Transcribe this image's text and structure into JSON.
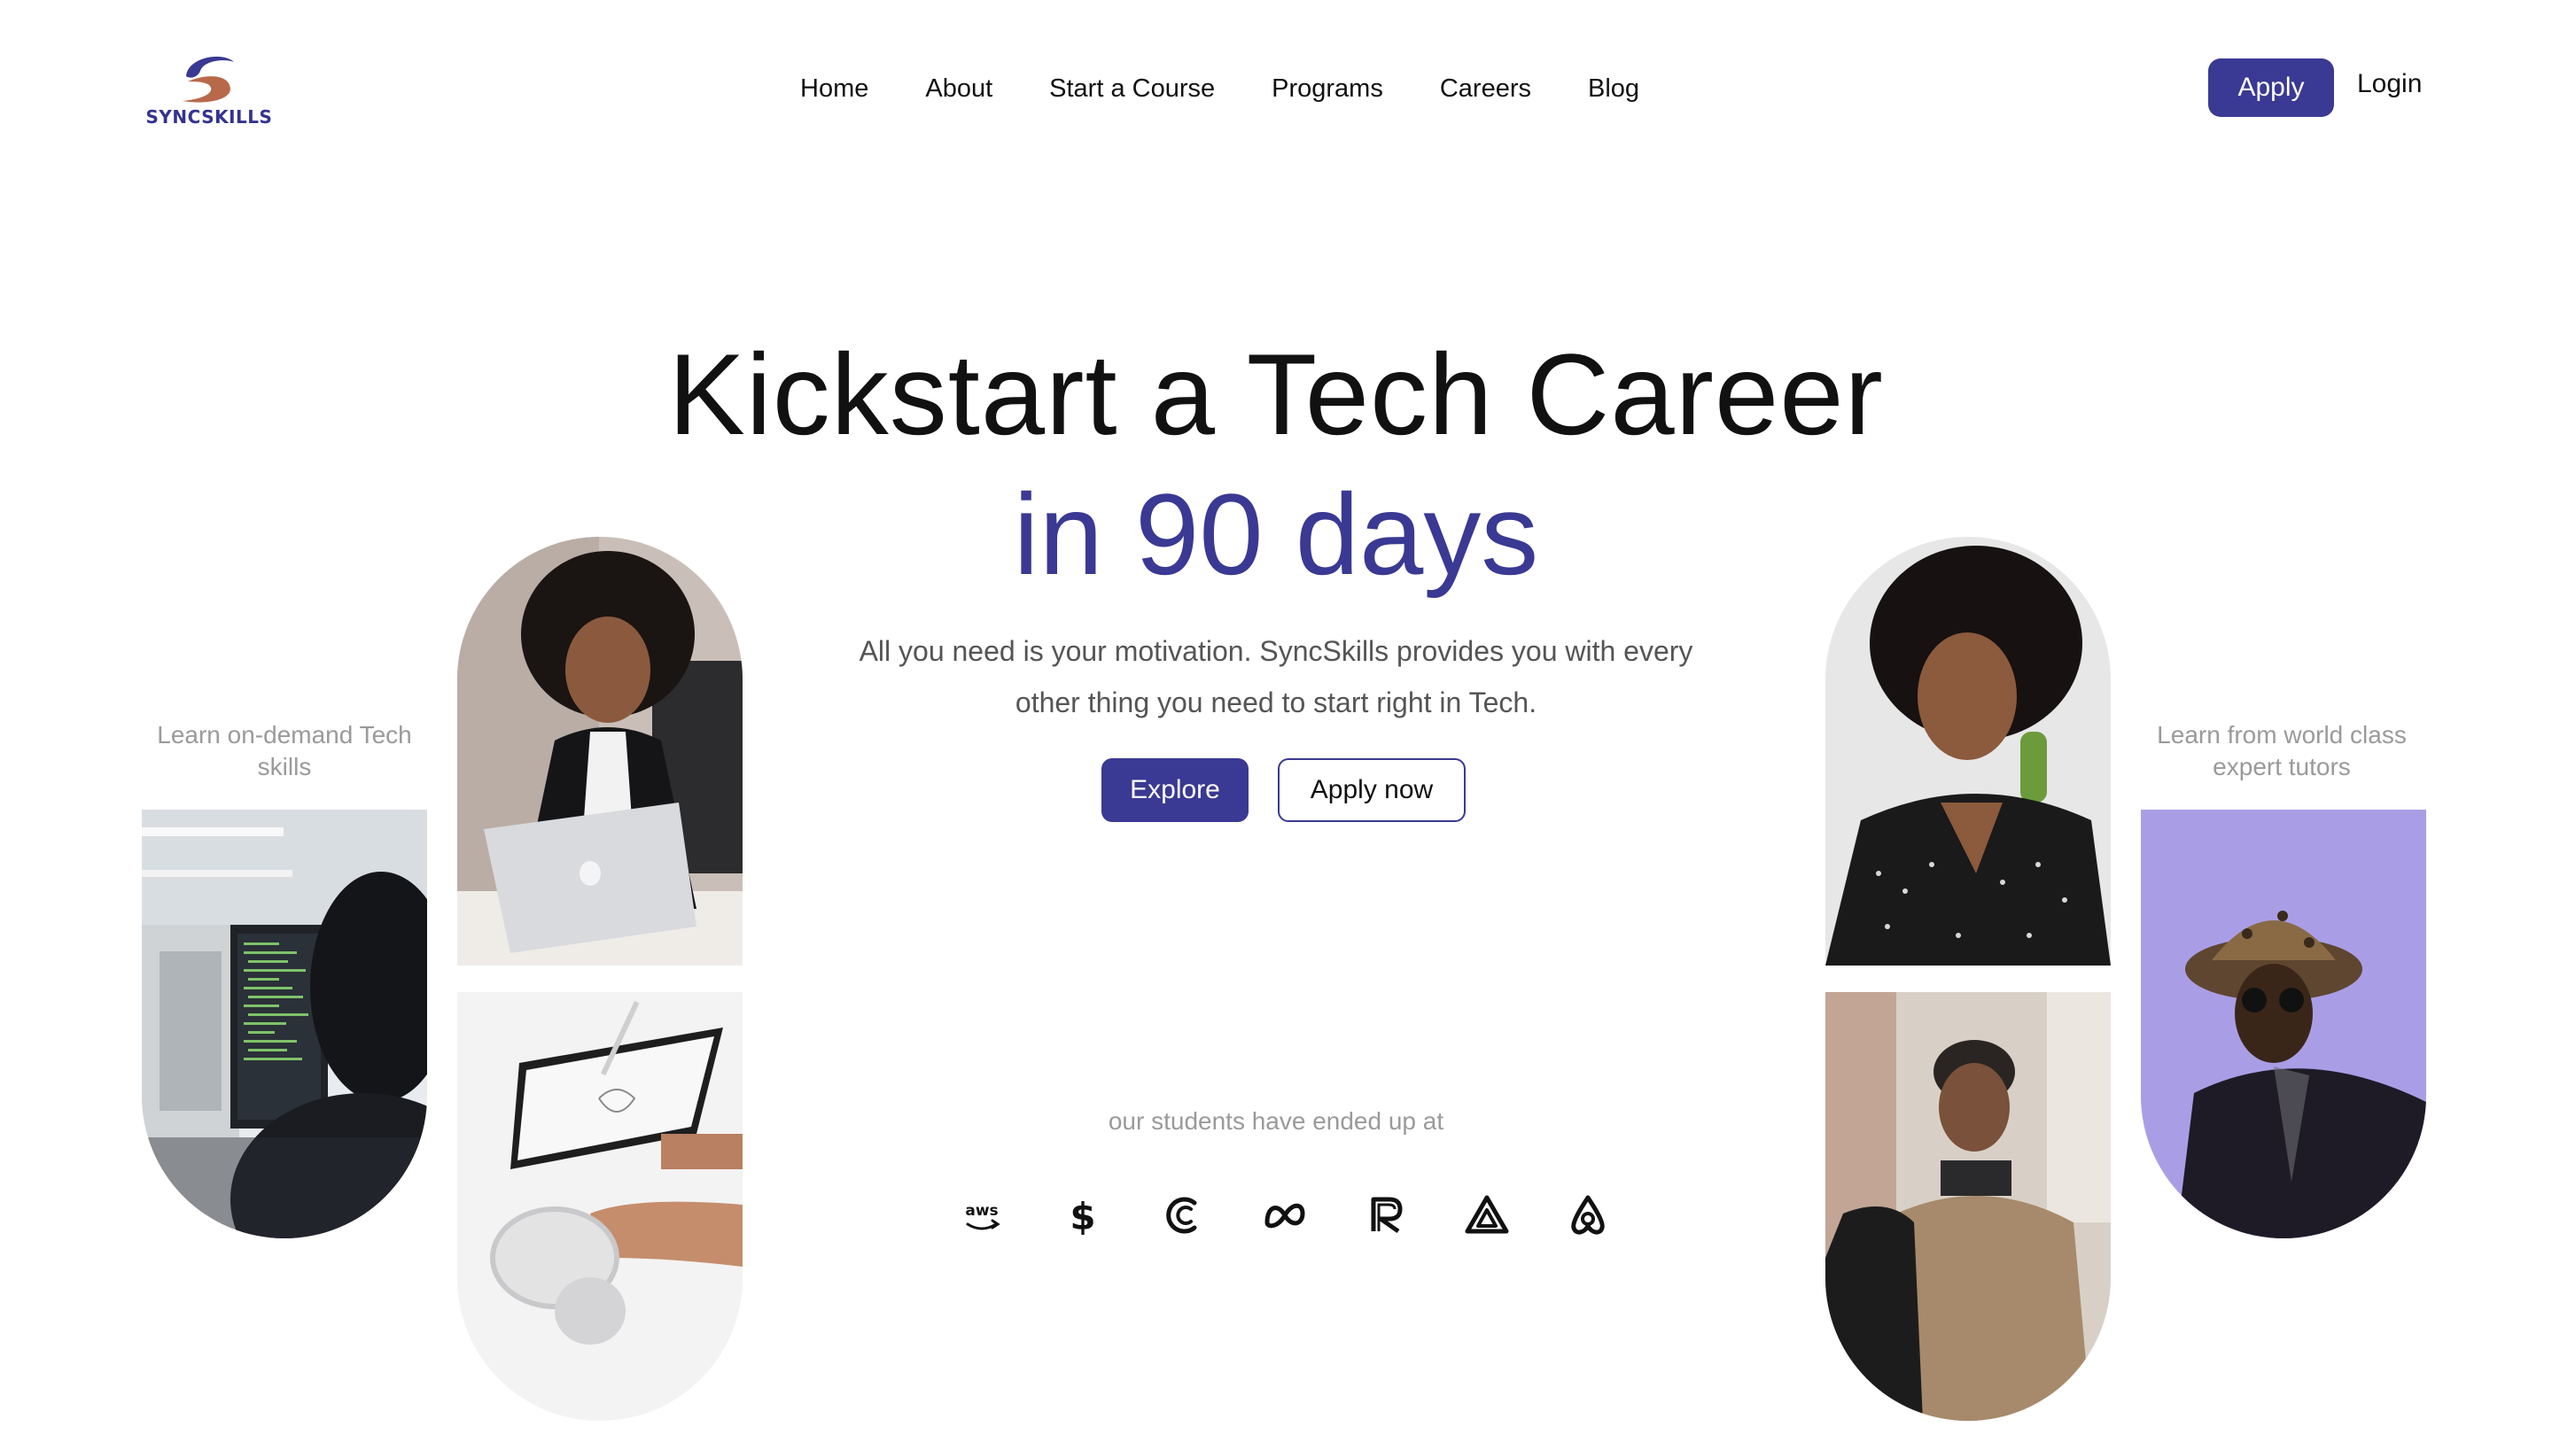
{
  "brand": {
    "name": "SYNCSKILLS",
    "color": "#3a3993",
    "accent": "#b8694a"
  },
  "nav": {
    "items": [
      {
        "label": "Home"
      },
      {
        "label": "About"
      },
      {
        "label": "Start a Course"
      },
      {
        "label": "Programs"
      },
      {
        "label": "Careers"
      },
      {
        "label": "Blog"
      }
    ],
    "apply_label": "Apply",
    "login_label": "Login"
  },
  "hero": {
    "title_line1": "Kickstart a Tech Career",
    "title_line2": "in 90 days",
    "subtitle": "All you need is your motivation. SyncSkills provides you with every other thing you need to start right in Tech.",
    "explore_label": "Explore",
    "apply_now_label": "Apply now"
  },
  "captions": {
    "left": "Learn on-demand Tech skills",
    "right": "Learn from world class expert tutors"
  },
  "students": {
    "label": "our students have ended up at",
    "partners": [
      {
        "icon": "aws-icon"
      },
      {
        "icon": "dollar-s-icon"
      },
      {
        "icon": "c-logo-icon"
      },
      {
        "icon": "meta-icon"
      },
      {
        "icon": "r-logo-icon"
      },
      {
        "icon": "triangle-logo-icon"
      },
      {
        "icon": "airbnb-icon"
      }
    ]
  }
}
